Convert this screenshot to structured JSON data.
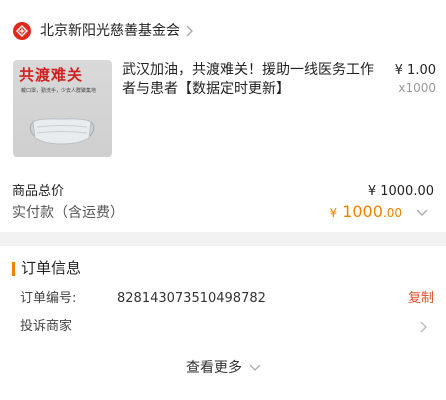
{
  "store": {
    "name": "北京新阳光慈善基金会",
    "icon": "charity-logo-icon",
    "brand_color": "#e0281d"
  },
  "product": {
    "thumbnail": {
      "title": "共渡难关",
      "subtitle": "戴口罩，勤洗手，少去人群聚集地"
    },
    "title": "武汉加油，共渡难关！援助一线医务工作者与患者【数据定时更新】",
    "price": "¥ 1.00",
    "quantity": "x1000"
  },
  "summary": {
    "total_label": "商品总价",
    "total_value": "¥ 1000.00",
    "paid_label": "实付款（含运费）",
    "paid_symbol": "¥",
    "paid_integer": "1000",
    "paid_decimal": ".00",
    "accent_color": "#f08300"
  },
  "order_info": {
    "title": "订单信息",
    "order_no_label": "订单编号:",
    "order_no_value": "828143073510498782",
    "copy_label": "复制",
    "complain_label": "投诉商家",
    "more_label": "查看更多"
  }
}
